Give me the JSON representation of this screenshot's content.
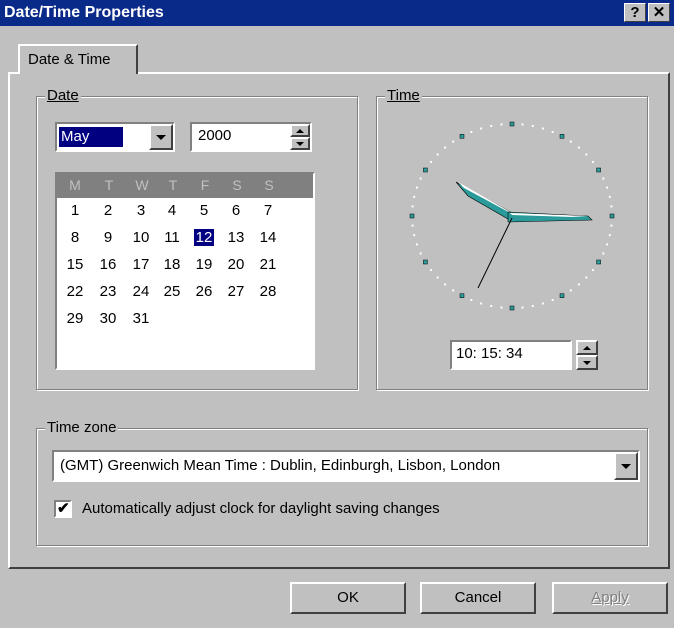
{
  "window": {
    "title": "Date/Time Properties",
    "help_glyph": "?",
    "close_glyph": "✕"
  },
  "tabs": [
    {
      "label": "Date & Time"
    }
  ],
  "date_group": {
    "legend": "Date",
    "month": "May",
    "year": "2000",
    "weekday_headers": [
      "M",
      "T",
      "W",
      "T",
      "F",
      "S",
      "S"
    ],
    "weeks": [
      [
        "1",
        "2",
        "3",
        "4",
        "5",
        "6",
        "7"
      ],
      [
        "8",
        "9",
        "10",
        "11",
        "12",
        "13",
        "14"
      ],
      [
        "15",
        "16",
        "17",
        "18",
        "19",
        "20",
        "21"
      ],
      [
        "22",
        "23",
        "24",
        "25",
        "26",
        "27",
        "28"
      ],
      [
        "29",
        "30",
        "31",
        "",
        "",
        "",
        ""
      ]
    ],
    "selected_day": "12"
  },
  "time_group": {
    "legend": "Time",
    "time_value": "10: 15: 34"
  },
  "timezone_group": {
    "legend": "Time zone",
    "selected_zone": "(GMT) Greenwich Mean Time : Dublin, Edinburgh, Lisbon, London",
    "dst_label": "Automatically adjust clock for daylight saving changes",
    "dst_checked": true
  },
  "buttons": {
    "ok": "OK",
    "cancel": "Cancel",
    "apply": "Apply"
  },
  "colors": {
    "titlebar": "#0a2a8a",
    "face": "#c0c0c0",
    "selection": "#000080",
    "clock_hand": "#2a9a9a"
  },
  "icons": {
    "dropdown": "chevron-down-icon",
    "spin": "spin-arrows-icon",
    "check": "checkmark-icon"
  }
}
